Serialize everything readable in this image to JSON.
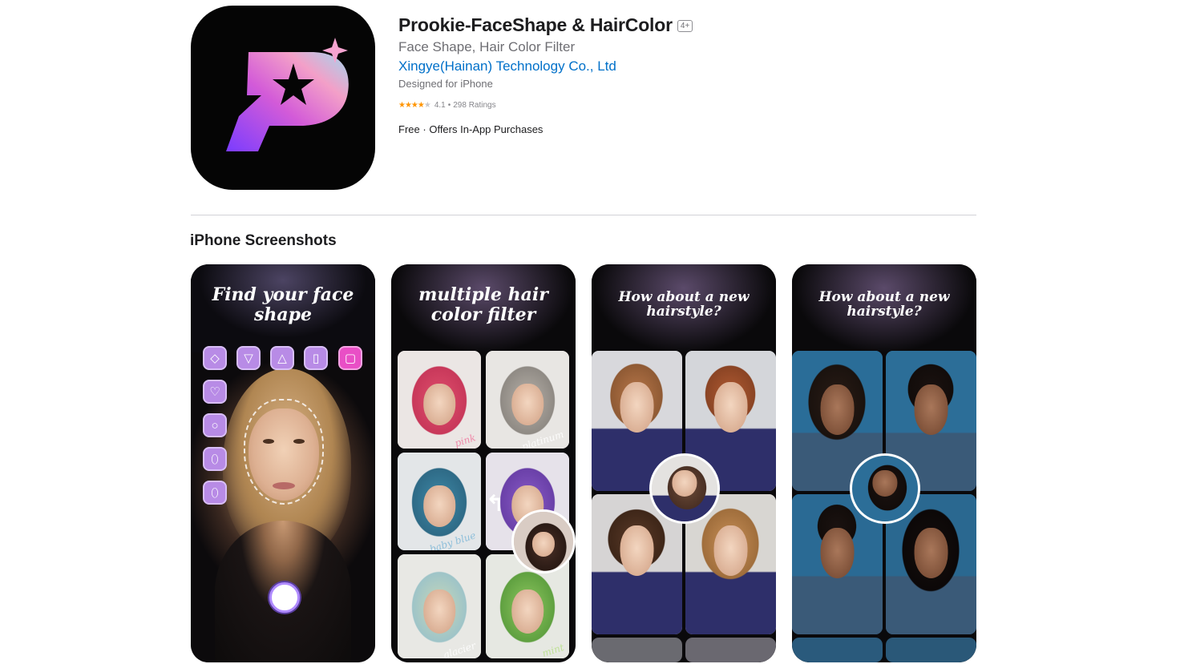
{
  "app": {
    "title": "Prookie-FaceShape & HairColor",
    "age_rating": "4+",
    "subtitle": "Face Shape, Hair Color Filter",
    "developer": "Xingye(Hainan) Technology Co., Ltd",
    "designed_for": "Designed for iPhone",
    "rating": {
      "stars": "★★★★",
      "dim_star": "★",
      "value": "4.1",
      "separator": "•",
      "count": "298 Ratings",
      "score": 4.1
    },
    "price": "Free",
    "price_separator": "·",
    "iap": "Offers In-App Purchases"
  },
  "section": {
    "title": "iPhone Screenshots"
  },
  "screenshots": [
    {
      "caption_line1": "Find your face",
      "caption_line2": "shape",
      "shape_icons": [
        "diamond-icon",
        "triangle-down-icon",
        "triangle-up-icon",
        "rectangle-icon",
        "square-icon",
        "heart-icon",
        "circle-icon",
        "oval-icon",
        "oblong-icon"
      ]
    },
    {
      "caption_line1": "multiple hair",
      "caption_line2": "color filter",
      "labels": [
        "pink",
        "platinum",
        "baby blue",
        "",
        "glacier",
        "mint"
      ]
    },
    {
      "caption_line1": "How about a new",
      "caption_line2": "hairstyle?"
    },
    {
      "caption_line1": "How about a new",
      "caption_line2": "hairstyle?"
    }
  ],
  "colors": {
    "link": "#0070c9",
    "star": "#ff9500",
    "shape_button": "#b88be6",
    "shape_button_selected": "#e94fc6"
  }
}
